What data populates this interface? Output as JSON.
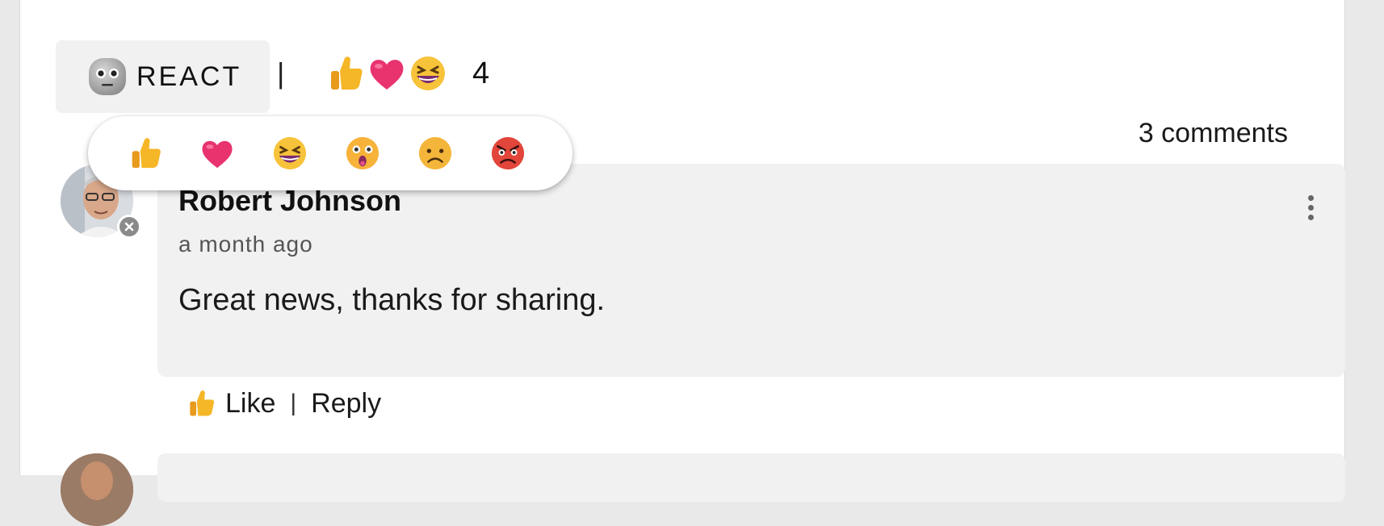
{
  "reactions_bar": {
    "react_label": "REACT",
    "react_icon": "neutral-face-icon",
    "separator": "|",
    "summary_icons": [
      "thumbs-up-icon",
      "heart-icon",
      "laughing-face-icon"
    ],
    "summary_count": "4"
  },
  "reaction_picker": {
    "options": [
      "thumbs-up-icon",
      "heart-icon",
      "laughing-face-icon",
      "surprised-face-icon",
      "sad-face-icon",
      "angry-face-icon"
    ]
  },
  "comments_header": {
    "count_label": "3 comments"
  },
  "comments": [
    {
      "author": "Robert Johnson",
      "timestamp": "a month ago",
      "text": "Great news, thanks for sharing.",
      "like_label": "Like",
      "separator": "|",
      "reply_label": "Reply"
    }
  ],
  "colors": {
    "background": "#e9e9e9",
    "card": "#ffffff",
    "comment_bg": "#f1f1f1",
    "heart": "#e8336f",
    "thumb": "#f5b627"
  }
}
